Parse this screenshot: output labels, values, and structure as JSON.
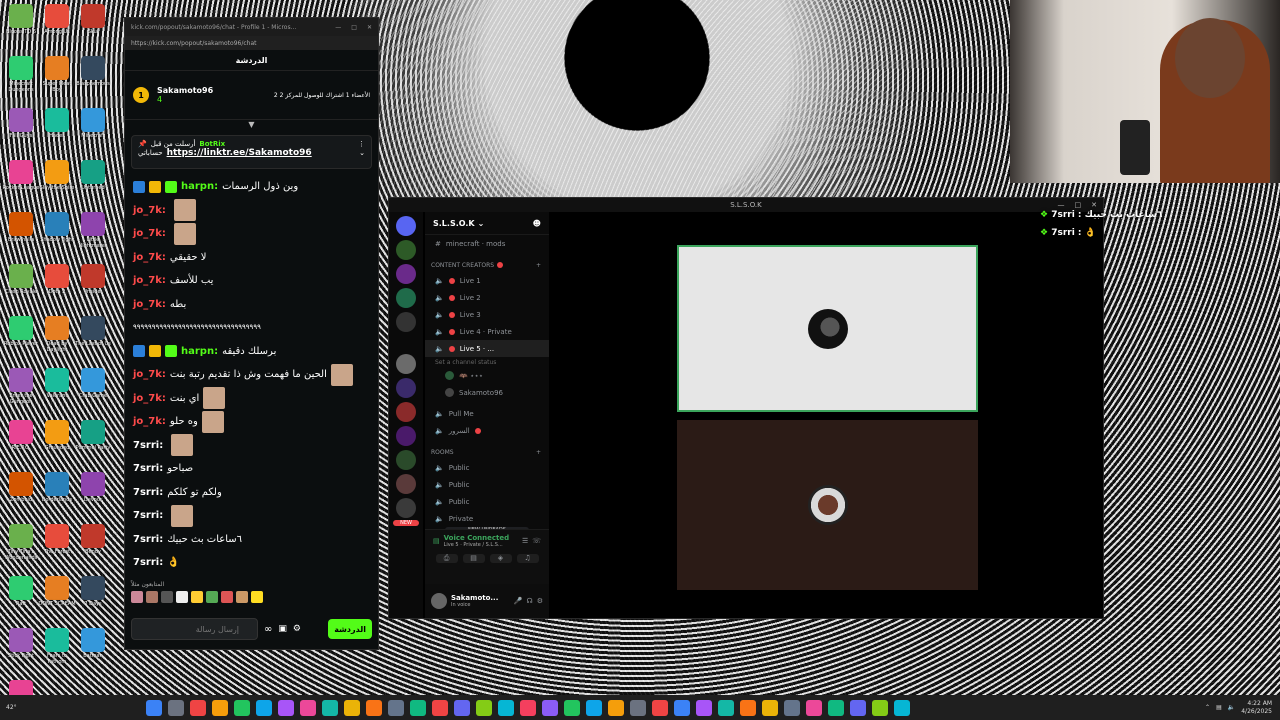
{
  "desktop": {
    "icons": [
      "Bloons TD 6",
      "Among Us",
      "Skul",
      "Minecraft Dungeons",
      "Super Meat Boy",
      "Blasphemous",
      "Fall Guys",
      "Hades",
      "Minecraft",
      "Rocket League",
      "Slay the Spire",
      "Unturned",
      "Brawlhalla",
      "Shadow Fight",
      "Little Nightmares",
      "Clash Royale",
      "Dota 2",
      "Inside",
      "Roblox Player",
      "Dead by Daylight",
      "The Last of Us",
      "Enter the Gungeon",
      "Valorant",
      "Crab Game",
      "R.E.P.O.",
      "Grounded",
      "Pummel Party",
      "Zomboid",
      "Borderlands",
      "Devour",
      "Tiny Tina's Wonderlands",
      "The Forest",
      "Bendy",
      "Raft",
      "DONT SCREAM",
      "7 Days",
      "Stick Fight",
      "Fears to Fathom",
      "Batman",
      "Sons Of The Forest"
    ]
  },
  "kick": {
    "window_title": "kick.com/popout/sakamoto96/chat - Profile 1 - Micros...",
    "url": "https://kick.com/popout/sakamoto96/chat",
    "header": "الدردشة",
    "leaderboard": {
      "rank": "1",
      "user": "Sakamoto96",
      "count": "4",
      "goal_text": "2 الأعضاء 1 اشتراك للوصول للمركز 2"
    },
    "pinned": {
      "by": "أرسلت من قبل",
      "bot": "BotRix",
      "prefix": "حساباتي",
      "link": "https://linktr.ee/Sakamoto96"
    },
    "messages": [
      {
        "user": "harpn:",
        "color": "green",
        "text": "وين ذول الرسمات",
        "badges": true
      },
      {
        "user": "jo_7k:",
        "color": "red",
        "text": "",
        "emote": true
      },
      {
        "user": "jo_7k:",
        "color": "red",
        "text": "",
        "emote": true
      },
      {
        "user": "jo_7k:",
        "color": "red",
        "text": "لا حقيقي"
      },
      {
        "user": "jo_7k:",
        "color": "red",
        "text": "يب للأسف"
      },
      {
        "user": "jo_7k:",
        "color": "red",
        "text": "بطه"
      },
      {
        "user": "",
        "color": "white",
        "text": "٩٩٩٩٩٩٩٩٩٩٩٩٩٩٩٩٩٩٩٩٩٩٩٩٩٩٩٩٩٩٩٩٩٩"
      },
      {
        "user": "harpn:",
        "color": "green",
        "text": "برسلك دقيقه",
        "badges": true
      },
      {
        "user": "jo_7k:",
        "color": "red",
        "text": "الحين ما فهمت وش ذا تقديم رتبة بنت",
        "emote": true
      },
      {
        "user": "jo_7k:",
        "color": "red",
        "text": "اي بنت",
        "emote": true
      },
      {
        "user": "jo_7k:",
        "color": "red",
        "text": "وه حلو",
        "emote": true
      },
      {
        "user": "7srri:",
        "color": "white",
        "text": "",
        "emote": true
      },
      {
        "user": "7srri:",
        "color": "white",
        "text": "صباحو"
      },
      {
        "user": "7srri:",
        "color": "white",
        "text": "ولكم تو كلكم"
      },
      {
        "user": "7srri:",
        "color": "white",
        "text": "",
        "emote": true
      },
      {
        "user": "7srri:",
        "color": "white",
        "text": "٦ساعات بث حبيك"
      },
      {
        "user": "7srri:",
        "color": "white",
        "text": "👌"
      }
    ],
    "chatters_label": "المتابعون مثلاً",
    "input_placeholder": "إرسال رسالة",
    "send_label": "الدردشة"
  },
  "discord": {
    "window_title": "S.L.S.O.K",
    "server_name": "S.L.S.O.K",
    "top_channel": "minecraft · mods",
    "category_creators": "CONTENT CREATORS",
    "channels": [
      "Live 1",
      "Live 2",
      "Live 3",
      "Live 4 · Private",
      "Live 5 · ..."
    ],
    "channel_status_hint": "Set a channel status",
    "voice_users": [
      "🦇 ⋆⋆⋆",
      "Sakamoto96"
    ],
    "pull_me": "Pull Me",
    "al_sarour": "السرور",
    "category_rooms": "ROOMS",
    "rooms": [
      "Public",
      "Public",
      "Public",
      "Private"
    ],
    "new_unreads": "NEW UNREADS",
    "voice_connected": "Voice Connected",
    "voice_channel": "Live 5 · Private / S.L.S...",
    "username": "Sakamoto...",
    "user_status": "In voice",
    "new_badge": "NEW"
  },
  "overlay": {
    "lines": [
      {
        "user": "7srri",
        "text": "٦ساعات بث حبيك"
      },
      {
        "user": "7srri",
        "text": "👌"
      }
    ]
  },
  "taskbar": {
    "weather": "42°",
    "time": "4:22 AM",
    "date": "4/26/2025"
  },
  "colors": {
    "kick_green": "#53fc18",
    "discord_green": "#3ba55c",
    "red_user": "#ff4b4b"
  }
}
